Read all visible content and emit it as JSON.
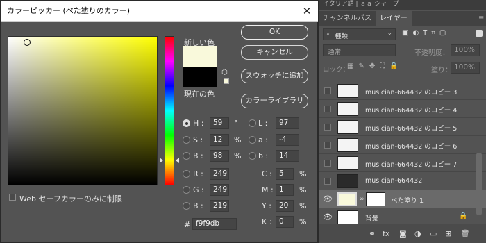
{
  "dialog": {
    "title": "カラーピッカー (べた塗りのカラー)",
    "close": "✕",
    "new_label": "新しい色",
    "current_label": "現在の色",
    "buttons": {
      "ok": "OK",
      "cancel": "キャンセル",
      "add_swatch": "スウォッチに追加",
      "libraries": "カラーライブラリ"
    },
    "hsb": [
      {
        "label": "H :",
        "value": "59",
        "unit": "°",
        "selected": true
      },
      {
        "label": "S :",
        "value": "12",
        "unit": "%",
        "selected": false
      },
      {
        "label": "B :",
        "value": "98",
        "unit": "%",
        "selected": false
      }
    ],
    "rgb": [
      {
        "label": "R :",
        "value": "249"
      },
      {
        "label": "G :",
        "value": "249"
      },
      {
        "label": "B :",
        "value": "219"
      }
    ],
    "lab": [
      {
        "label": "L :",
        "value": "97"
      },
      {
        "label": "a :",
        "value": "-4"
      },
      {
        "label": "b :",
        "value": "14"
      }
    ],
    "cmyk": [
      {
        "label": "C :",
        "value": "5",
        "unit": "%"
      },
      {
        "label": "M :",
        "value": "1",
        "unit": "%"
      },
      {
        "label": "Y :",
        "value": "20",
        "unit": "%"
      },
      {
        "label": "K :",
        "value": "0",
        "unit": "%"
      }
    ],
    "hex_label": "#",
    "hex_value": "f9f9db",
    "web_only_label": "Web セーフカラーのみに制限",
    "new_color": "#f9f9db",
    "current_color": "#000000"
  },
  "panel": {
    "top_tabs": "イタリア語 | ａａ シャープ",
    "tabs": [
      "チャンネル",
      "パス",
      "レイヤー"
    ],
    "kind_filter": "種類",
    "blend_mode": "通常",
    "opacity_label": "不透明度：",
    "opacity_value": "100%",
    "lock_label": "ロック：",
    "fill_label": "塗り：",
    "fill_value": "100%",
    "layers": [
      {
        "name": "musician-664432 のコピー 3",
        "visible": false
      },
      {
        "name": "musician-664432 のコピー 4",
        "visible": false
      },
      {
        "name": "musician-664432 のコピー 5",
        "visible": false
      },
      {
        "name": "musician-664432 のコピー 6",
        "visible": false
      },
      {
        "name": "musician-664432 のコピー 7",
        "visible": false
      },
      {
        "name": "musician-664432",
        "visible": false
      },
      {
        "name": "べた塗り 1",
        "visible": true
      },
      {
        "name": "背景",
        "visible": true
      }
    ]
  }
}
